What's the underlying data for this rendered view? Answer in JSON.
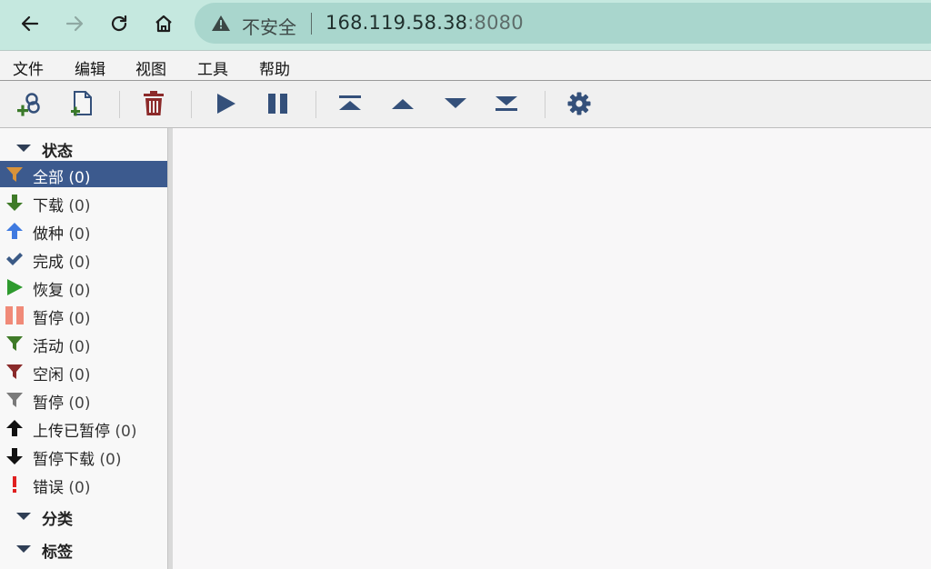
{
  "browser": {
    "insecure_label": "不安全",
    "url_host": "168.119.58.38",
    "url_port": ":8080"
  },
  "menu": {
    "file": "文件",
    "edit": "编辑",
    "view": "视图",
    "tools": "工具",
    "help": "帮助"
  },
  "sidebar": {
    "status_header": "状态",
    "category_header": "分类",
    "tags_header": "标签",
    "filters": [
      {
        "label": "全部",
        "count": "(0)",
        "icon": "filter-icon",
        "color": "#d9933a"
      },
      {
        "label": "下载",
        "count": "(0)",
        "icon": "arrow-down-icon",
        "color": "#3f7b28"
      },
      {
        "label": "做种",
        "count": "(0)",
        "icon": "arrow-up-icon",
        "color": "#3f7ae0"
      },
      {
        "label": "完成",
        "count": "(0)",
        "icon": "check-icon",
        "color": "#3b5a86"
      },
      {
        "label": "恢复",
        "count": "(0)",
        "icon": "play-icon",
        "color": "#2e9a2e"
      },
      {
        "label": "暂停",
        "count": "(0)",
        "icon": "pause-icon",
        "color": "#f08a78"
      },
      {
        "label": "活动",
        "count": "(0)",
        "icon": "filter-icon",
        "color": "#3f7b28"
      },
      {
        "label": "空闲",
        "count": "(0)",
        "icon": "filter-icon",
        "color": "#8a2a2a"
      },
      {
        "label": "暂停",
        "count": "(0)",
        "icon": "filter-icon",
        "color": "#7a7a7a"
      },
      {
        "label": "上传已暂停",
        "count": "(0)",
        "icon": "arrow-up-icon",
        "color": "#111111"
      },
      {
        "label": "暂停下载",
        "count": "(0)",
        "icon": "arrow-down-icon",
        "color": "#111111"
      },
      {
        "label": "错误",
        "count": "(0)",
        "icon": "exclamation-icon",
        "color": "#e02020"
      }
    ]
  },
  "colors": {
    "accent_selected": "#3c5a8e",
    "toolbar_icon": "#34507a",
    "delete_icon": "#8c2a2a",
    "add_icon": "#3b7a2a"
  }
}
